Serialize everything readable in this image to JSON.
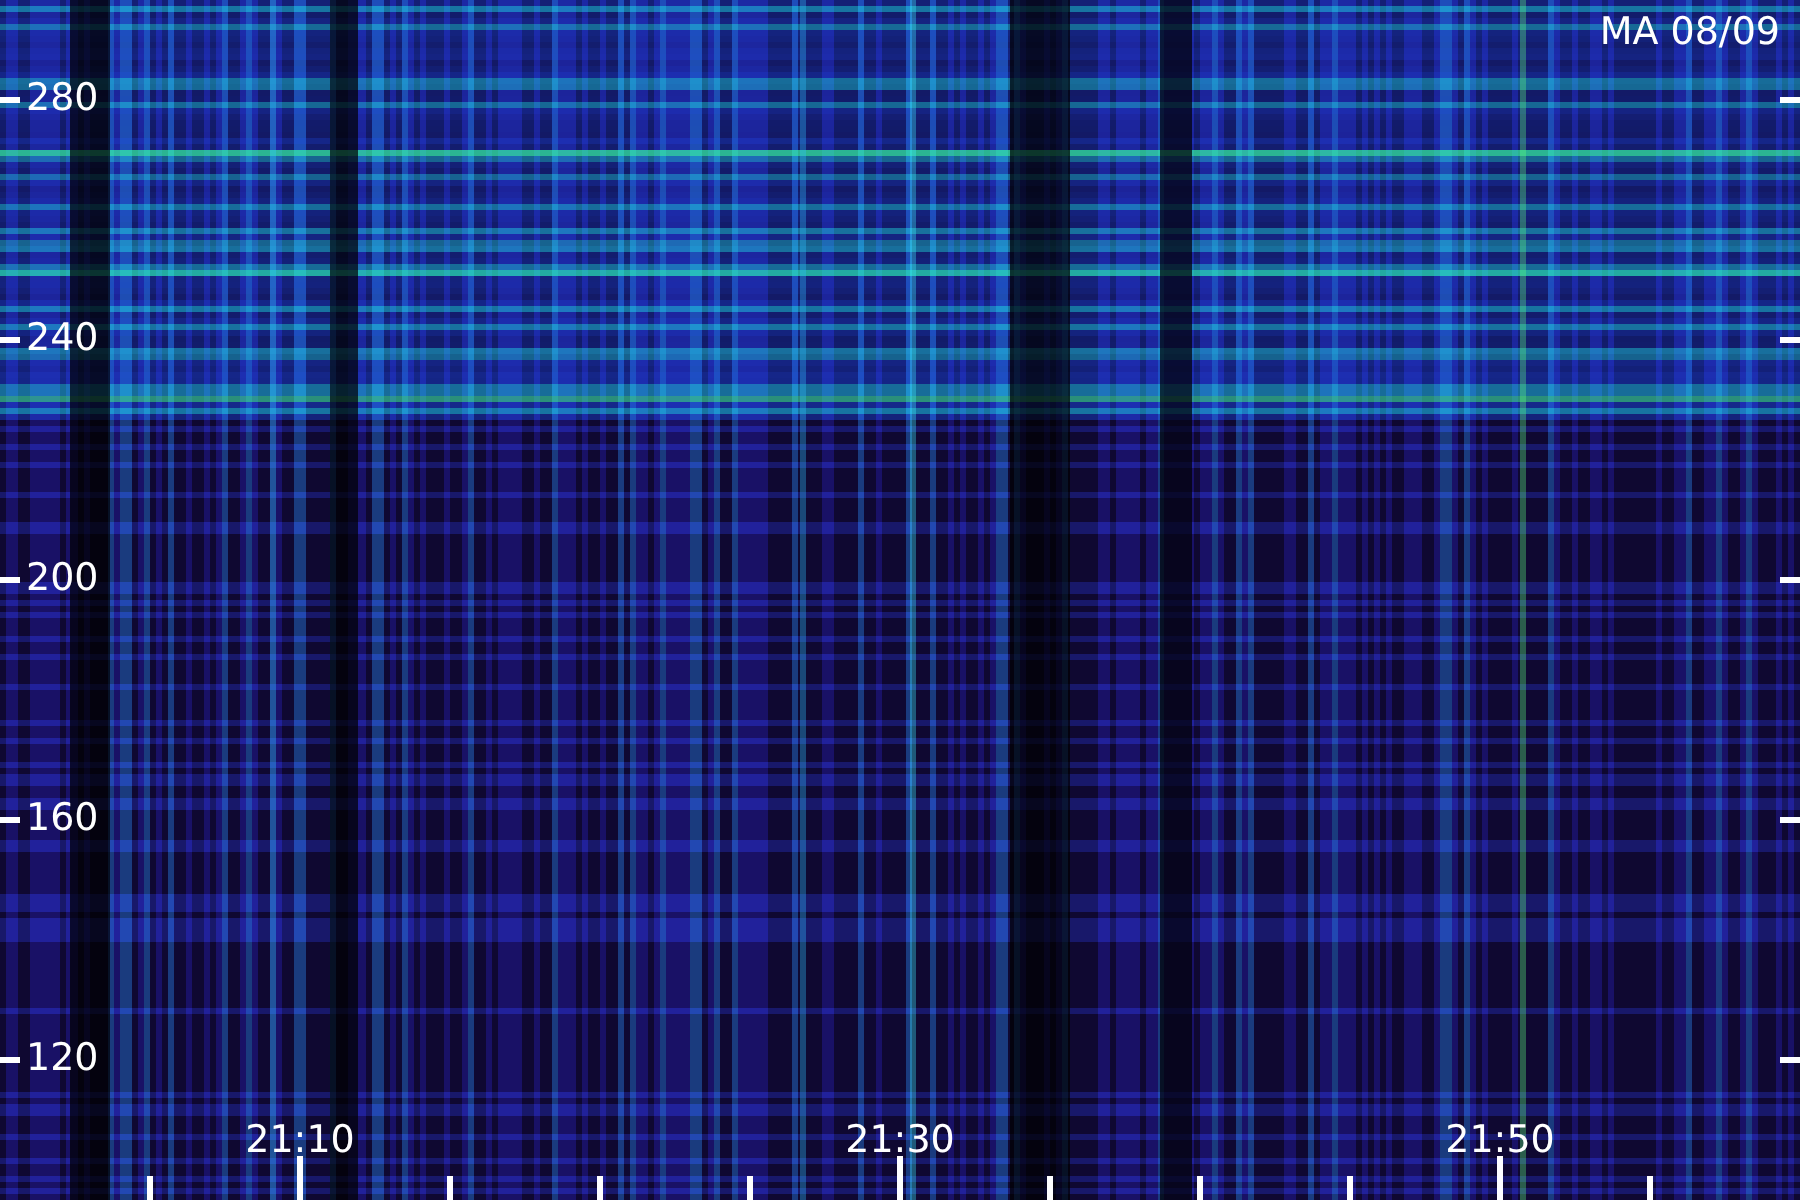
{
  "title": "MA 08/09",
  "y_axis_labels": [
    "280",
    "240",
    "200",
    "160",
    "120"
  ],
  "x_axis_labels": [
    "21:10",
    "21:30",
    "21:50"
  ]
}
